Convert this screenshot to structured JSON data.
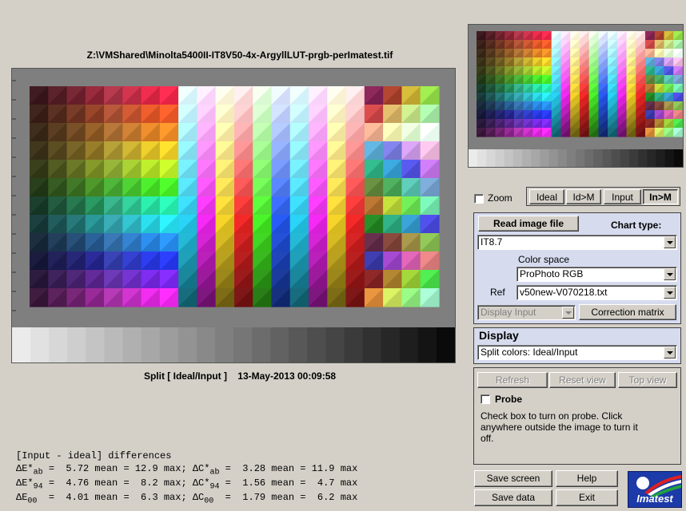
{
  "image": {
    "file_path": "Z:\\VMShared\\Minolta5400II-IT8V50-4x-ArgyllLUT-prgb-perImatest.tif",
    "caption_mode": "Split [ Ideal/Input ]",
    "caption_date": "13-May-2013 00:09:58"
  },
  "differences": {
    "header": "[Input - ideal] differences",
    "lines": [
      {
        "l1": "ΔE*",
        "s1": "ab",
        "m1": " =  5.72 mean = 12.9 max; ΔC*",
        "s2": "ab",
        "m2": " =  3.28 mean = 11.9 max"
      },
      {
        "l1": "ΔE*",
        "s1": "94",
        "m1": " =  4.76 mean =  8.2 max; ΔC*",
        "s2": "94",
        "m2": " =  1.56 mean =  4.7 max"
      },
      {
        "l1": "ΔE",
        "s1": "00",
        "m1": "  =  4.01 mean =  6.3 max; ΔC",
        "s2": "00",
        "m2": "  =  1.79 mean =  6.2 max"
      }
    ]
  },
  "controls": {
    "zoom_label": "Zoom",
    "view_buttons": [
      "Ideal",
      "Id>M",
      "Input",
      "In>M"
    ],
    "read_image_file": "Read image file",
    "chart_type_label": "Chart type:",
    "chart_type_value": "IT8.7",
    "color_space_label": "Color space",
    "color_space_value": "ProPhoto RGB",
    "ref_label": "Ref",
    "ref_value": "v50new-V070218.txt",
    "display_input_value": "Display Input",
    "correction_matrix": "Correction matrix",
    "display_title": "Display",
    "display_value": "Split colors: Ideal/Input",
    "refresh": "Refresh",
    "reset_view": "Reset view",
    "top_view": "Top view",
    "probe_label": "Probe",
    "probe_help": "Check box to turn on probe. Click anywhere outside the image to turn it off.",
    "save_screen": "Save screen",
    "help": "Help",
    "save_data": "Save data",
    "exit": "Exit",
    "logo_text": "Imatest"
  }
}
